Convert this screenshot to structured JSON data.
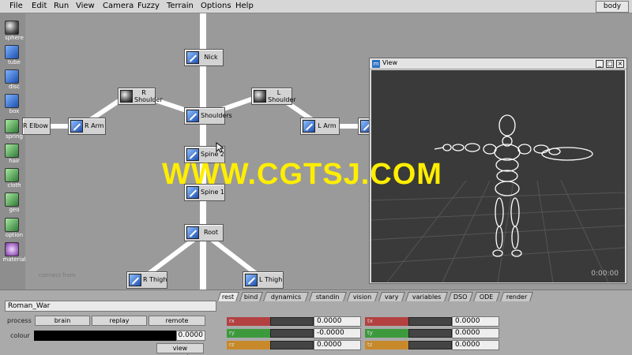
{
  "menu": [
    "File",
    "Edit",
    "Run",
    "View",
    "Camera",
    "Fuzzy",
    "Terrain",
    "Options",
    "Help"
  ],
  "body_button": "body",
  "tools": [
    {
      "label": "sphere",
      "icon": "sphere-icon"
    },
    {
      "label": "tube",
      "icon": "tube-icon"
    },
    {
      "label": "disc",
      "icon": "disc-icon"
    },
    {
      "label": "box",
      "icon": "box-icon"
    },
    {
      "label": "spring",
      "icon": "spring-icon"
    },
    {
      "label": "hair",
      "icon": "hair-icon"
    },
    {
      "label": "cloth",
      "icon": "cloth-icon"
    },
    {
      "label": "geo",
      "icon": "geo-icon"
    },
    {
      "label": "option",
      "icon": "option-icon"
    },
    {
      "label": "material",
      "icon": "material-icon"
    }
  ],
  "nodes": {
    "nick": "Nick",
    "r_shoulder": [
      "R",
      "Shoulder"
    ],
    "l_shoulder": [
      "L",
      "Shoulder"
    ],
    "r_elbow": "R Elbow",
    "r_arm": "R Arm",
    "shoulders": "Shoulders",
    "l_arm": "L Arm",
    "spine2": "Spine 2",
    "spine1": "Spine 1",
    "root": "Root",
    "r_thigh": "R Thigh",
    "l_thigh": "L Thigh"
  },
  "connect_hint": "connect from",
  "view_window": {
    "title": "View",
    "timecode": "0:00:00"
  },
  "watermark": "WWW.CGTSJ.COM",
  "bottom": {
    "name": "Roman_War",
    "process_label": "process",
    "process_buttons": [
      "brain",
      "replay",
      "remote"
    ],
    "colour_label": "colour",
    "colour_value": "0.0000",
    "view_geometry": "view geometry",
    "tabs": [
      "rest",
      "bind",
      "dynamics",
      "standin",
      "vision",
      "vary",
      "variables",
      "DSO",
      "ODE",
      "render"
    ],
    "rows": [
      {
        "l_label": "rx",
        "l_value": "0.0000",
        "l_color": "#b34141",
        "r_label": "tx",
        "r_value": "0.0000",
        "r_color": "#b34141"
      },
      {
        "l_label": "ry",
        "l_value": "-0.0000",
        "l_color": "#3c9a3c",
        "r_label": "ty",
        "r_value": "0.0000",
        "r_color": "#3c9a3c"
      },
      {
        "l_label": "rz",
        "l_value": "0.0000",
        "l_color": "#c8892a",
        "r_label": "tz",
        "r_value": "0.0000",
        "r_color": "#c8892a"
      }
    ]
  }
}
